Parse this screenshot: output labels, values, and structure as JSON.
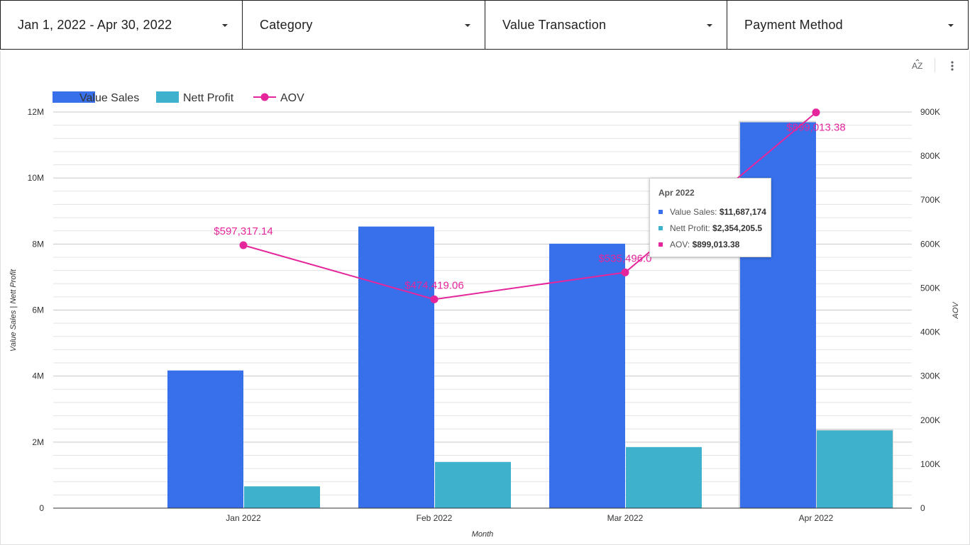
{
  "filters": {
    "date_range": "Jan 1, 2022 - Apr 30, 2022",
    "category": "Category",
    "value_transaction": "Value Transaction",
    "payment_method": "Payment Method"
  },
  "toolbar": {
    "sort_icon": "sort-az-icon",
    "more_icon": "more-vert-icon"
  },
  "colors": {
    "value_sales": "#3770ea",
    "nett_profit": "#3eb2cc",
    "aov": "#e5259b"
  },
  "chart_data": {
    "type": "bar",
    "categories": [
      "Jan 2022",
      "Feb 2022",
      "Mar 2022",
      "Apr 2022"
    ],
    "xlabel": "Month",
    "ylabel": "Value Sales | Nett Profit",
    "y2label": "AOV",
    "ylim": [
      0,
      12000000
    ],
    "y2lim": [
      0,
      900000
    ],
    "yticks": [
      "0",
      "2M",
      "4M",
      "6M",
      "8M",
      "10M",
      "12M"
    ],
    "y2ticks": [
      "0",
      "100K",
      "200K",
      "300K",
      "400K",
      "500K",
      "600K",
      "700K",
      "800K",
      "900K"
    ],
    "legend_position": "top-left",
    "grid": true,
    "series": [
      {
        "name": "Value Sales",
        "type": "bar",
        "axis": "left",
        "values": [
          4170000,
          8530000,
          8010000,
          11687174
        ]
      },
      {
        "name": "Nett Profit",
        "type": "bar",
        "axis": "left",
        "values": [
          660000,
          1400000,
          1850000,
          2354205.5
        ]
      },
      {
        "name": "AOV",
        "type": "line",
        "axis": "right",
        "values": [
          597317.14,
          474419.06,
          535496.0,
          899013.38
        ],
        "labels": [
          "$597,317.14",
          "$474,419.06",
          "$535,496.0",
          "$899,013.38"
        ]
      }
    ]
  },
  "tooltip": {
    "title": "Apr 2022",
    "rows": [
      {
        "label": "Value Sales: ",
        "value": "$11,687,174"
      },
      {
        "label": "Nett Profit: ",
        "value": "$2,354,205.5"
      },
      {
        "label": "AOV: ",
        "value": "$899,013.38"
      }
    ]
  }
}
